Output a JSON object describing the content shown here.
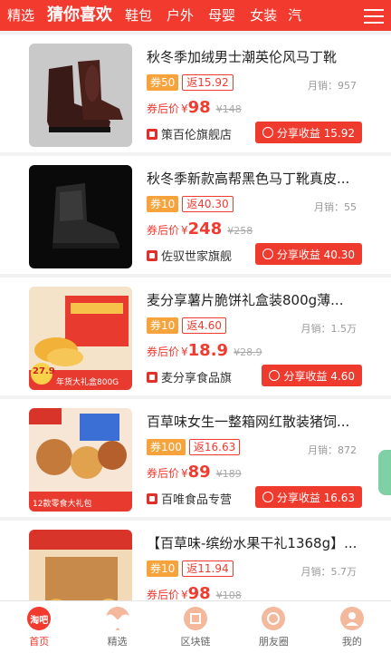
{
  "categories": [
    "精选",
    "猜你喜欢",
    "鞋包",
    "户外",
    "母婴",
    "女装",
    "汽"
  ],
  "colors": {
    "brand": "#f23a2f",
    "coupon": "#f7a33b",
    "navIcon": "#f4b89c"
  },
  "products": [
    {
      "title": "秋冬季加绒男士潮英伦风马丁靴",
      "coupon": "券50",
      "rebate": "返15.92",
      "after_label": "券后价",
      "yen": "¥",
      "price": "98",
      "original": "¥148",
      "sales": "月销：957",
      "shop": "策百伦旗舰店",
      "share": "分享收益 15.92"
    },
    {
      "title": "秋冬季新款高帮黑色马丁靴真皮...",
      "coupon": "券10",
      "rebate": "返40.30",
      "after_label": "券后价",
      "yen": "¥",
      "price": "248",
      "original": "¥258",
      "sales": "月销：55",
      "shop": "佐驭世家旗舰",
      "share": "分享收益 40.30"
    },
    {
      "title": "麦分享薯片脆饼礼盒装800g薄...",
      "coupon": "券10",
      "rebate": "返4.60",
      "after_label": "券后价",
      "yen": "¥",
      "price": "18.9",
      "original": "¥28.9",
      "sales": "月销：1.5万",
      "shop": "麦分享食品旗",
      "share": "分享收益 4.60"
    },
    {
      "title": "百草味女生一整箱网红散装猪饲...",
      "coupon": "券100",
      "rebate": "返16.63",
      "after_label": "券后价",
      "yen": "¥",
      "price": "89",
      "original": "¥189",
      "sales": "月销：872",
      "shop": "百唯食品专营",
      "share": "分享收益 16.63"
    },
    {
      "title": "【百草味-缤纷水果干礼1368g】...",
      "coupon": "券10",
      "rebate": "返11.94",
      "after_label": "券后价",
      "yen": "¥",
      "price": "98",
      "original": "¥108",
      "sales": "月销：5.7万",
      "shop": "",
      "share": ""
    }
  ],
  "thumbs": {
    "p3_badge": "27.9",
    "p3_text": "年货大礼盒800G",
    "p4_text": "12款零食大礼包"
  },
  "nav": [
    {
      "label": "首页",
      "icon": "home-taobao-icon",
      "icon_text": "淘吧"
    },
    {
      "label": "精选",
      "icon": "heart-icon"
    },
    {
      "label": "区块链",
      "icon": "blockchain-icon"
    },
    {
      "label": "朋友圈",
      "icon": "camera-icon"
    },
    {
      "label": "我的",
      "icon": "profile-icon"
    }
  ]
}
